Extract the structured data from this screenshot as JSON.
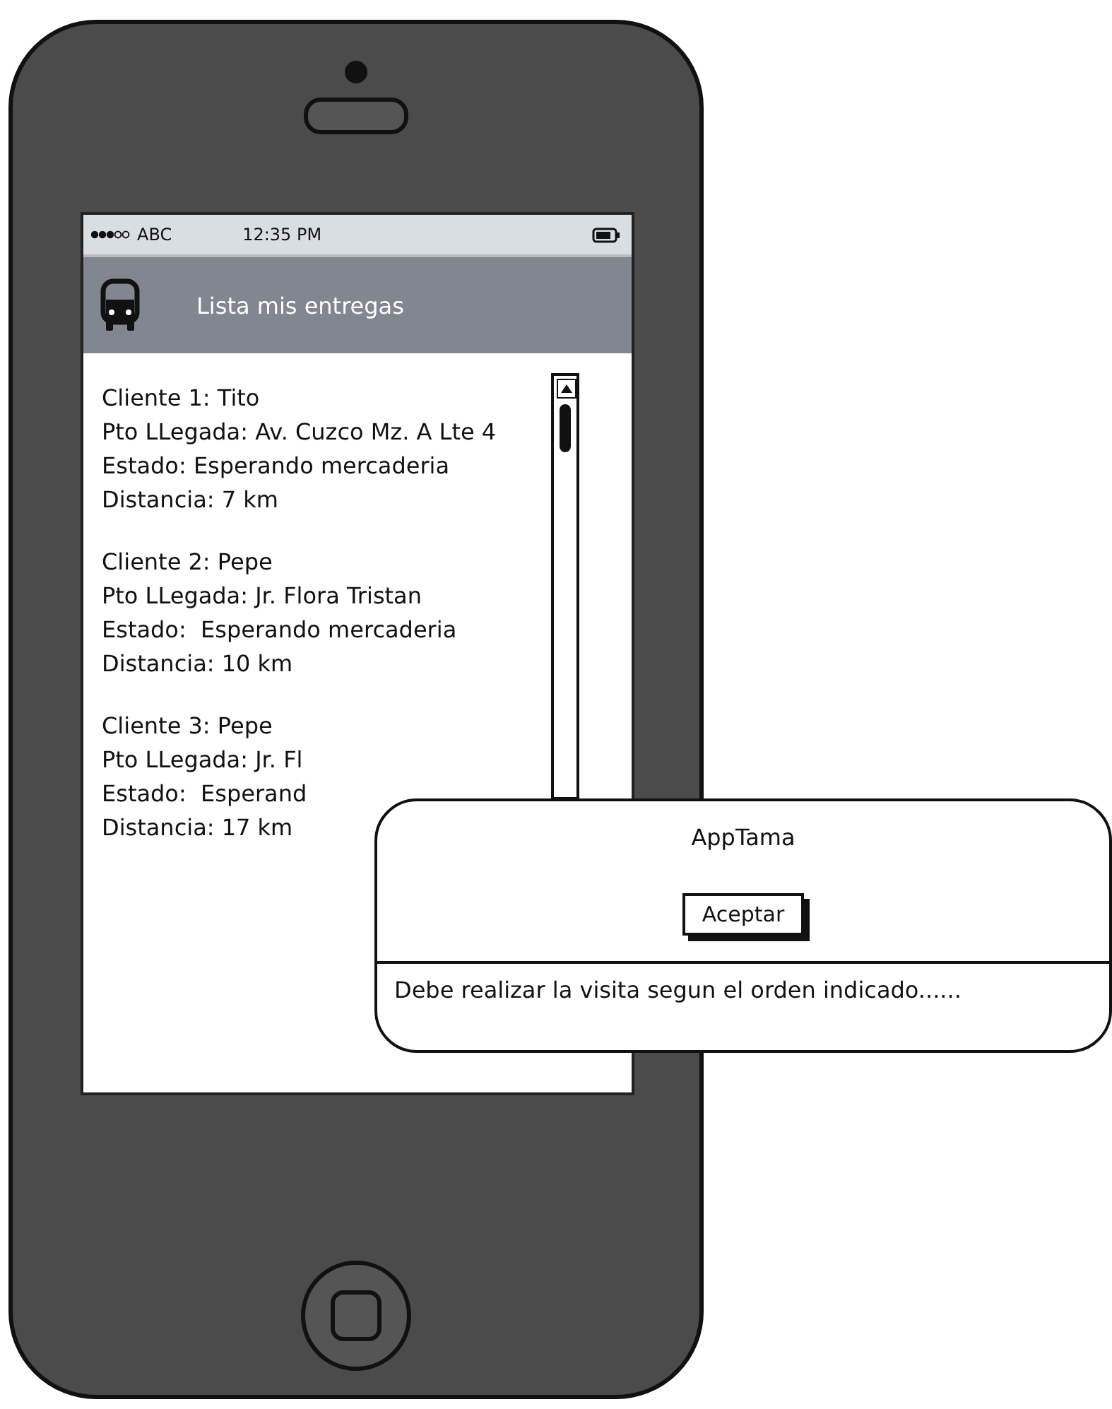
{
  "status_bar": {
    "carrier": "ABC",
    "time": "12:35 PM"
  },
  "header": {
    "title": "Lista mis entregas"
  },
  "deliveries": [
    {
      "lines": [
        "Cliente 1: Tito",
        "Pto LLegada: Av. Cuzco Mz. A Lte 4",
        "Estado: Esperando mercaderia",
        "Distancia: 7 km"
      ]
    },
    {
      "lines": [
        "Cliente 2: Pepe",
        "Pto LLegada: Jr. Flora Tristan",
        "Estado:  Esperando mercaderia",
        "Distancia: 10 km"
      ]
    },
    {
      "lines": [
        "Cliente 3: Pepe",
        "Pto LLegada: Jr. Fl",
        "Estado:  Esperand",
        "Distancia: 17 km"
      ]
    }
  ],
  "dialog": {
    "title": "AppTama",
    "button": "Aceptar",
    "message": "Debe realizar la visita segun el orden indicado......"
  }
}
